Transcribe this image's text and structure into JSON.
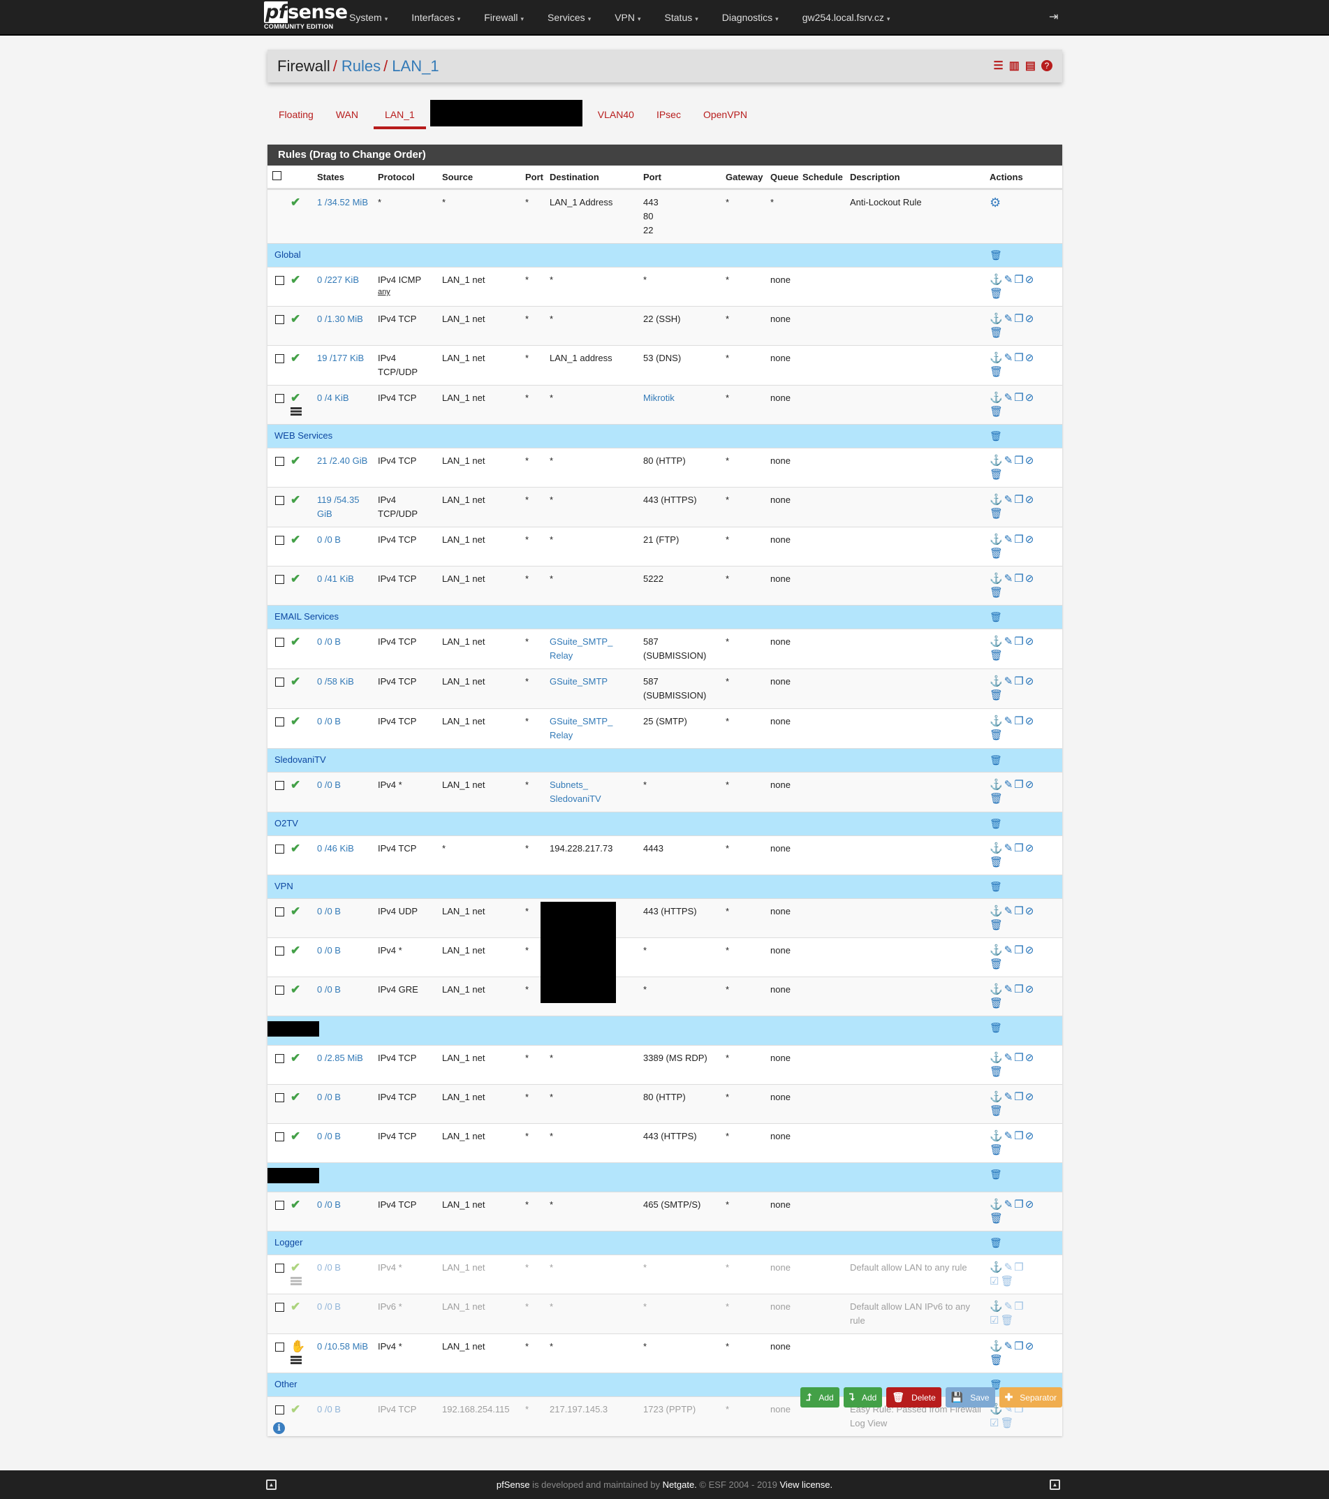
{
  "nav": {
    "brand": {
      "logo_pf": "pf",
      "logo_sense": "sense",
      "edition": "COMMUNITY EDITION"
    },
    "items": [
      {
        "label": "System"
      },
      {
        "label": "Interfaces"
      },
      {
        "label": "Firewall"
      },
      {
        "label": "Services"
      },
      {
        "label": "VPN"
      },
      {
        "label": "Status"
      },
      {
        "label": "Diagnostics"
      },
      {
        "label": "gw254.local.fsrv.cz"
      }
    ],
    "caret": "▾",
    "logout_icon": "⇥"
  },
  "breadcrumb": {
    "root": "Firewall",
    "sep": "/",
    "level1": "Rules",
    "level2": "LAN_1"
  },
  "header_icons": [
    "sliders-icon",
    "bar-chart-icon",
    "log-list-icon",
    "help-icon"
  ],
  "tabs": [
    {
      "label": "Floating",
      "active": false
    },
    {
      "label": "WAN",
      "active": false
    },
    {
      "label": "LAN_1",
      "active": true
    },
    {
      "label": "",
      "redacted": true
    },
    {
      "label": "VLAN40",
      "active": false
    },
    {
      "label": "IPsec",
      "active": false
    },
    {
      "label": "OpenVPN",
      "active": false
    }
  ],
  "panel": {
    "title": "Rules (Drag to Change Order)",
    "columns": [
      "",
      "",
      "States",
      "Protocol",
      "Source",
      "Port",
      "Destination",
      "Port",
      "Gateway",
      "Queue",
      "Schedule",
      "Description",
      "Actions"
    ],
    "anti_lockout": {
      "states": "1 /34.52 MiB",
      "protocol": "*",
      "source": "*",
      "sport": "*",
      "destination": "LAN_1 Address",
      "dport": "443\n80\n22",
      "gateway": "*",
      "queue": "*",
      "schedule": "",
      "description": "Anti-Lockout Rule"
    },
    "groups": [
      {
        "name": "Global",
        "rules": [
          {
            "states": "0 /227 KiB",
            "protocol": "IPv4 ICMP",
            "icmp_type": "any",
            "source": "LAN_1 net",
            "sport": "*",
            "destination": "*",
            "dport": "*",
            "gateway": "*",
            "queue": "none",
            "schedule": "",
            "description": "",
            "status": "pass"
          },
          {
            "states": "0 /1.30 MiB",
            "protocol": "IPv4 TCP",
            "source": "LAN_1 net",
            "sport": "*",
            "destination": "*",
            "dport": "22 (SSH)",
            "gateway": "*",
            "queue": "none",
            "schedule": "",
            "description": "",
            "status": "pass"
          },
          {
            "states": "19 /177 KiB",
            "protocol": "IPv4 TCP/UDP",
            "source": "LAN_1 net",
            "sport": "*",
            "destination": "LAN_1 address",
            "dport": "53 (DNS)",
            "gateway": "*",
            "queue": "none",
            "schedule": "",
            "description": "",
            "status": "pass"
          },
          {
            "states": "0 /4 KiB",
            "protocol": "IPv4 TCP",
            "source": "LAN_1 net",
            "sport": "*",
            "destination": "*",
            "dport": "Mikrotik",
            "dport_link": true,
            "gateway": "*",
            "queue": "none",
            "schedule": "",
            "description": "",
            "status": "pass",
            "log": true
          }
        ]
      },
      {
        "name": "WEB Services",
        "rules": [
          {
            "states": "21 /2.40 GiB",
            "protocol": "IPv4 TCP",
            "source": "LAN_1 net",
            "sport": "*",
            "destination": "*",
            "dport": "80 (HTTP)",
            "gateway": "*",
            "queue": "none",
            "schedule": "",
            "description": "",
            "status": "pass"
          },
          {
            "states": "119 /54.35 GiB",
            "protocol": "IPv4 TCP/UDP",
            "source": "LAN_1 net",
            "sport": "*",
            "destination": "*",
            "dport": "443 (HTTPS)",
            "gateway": "*",
            "queue": "none",
            "schedule": "",
            "description": "",
            "status": "pass"
          },
          {
            "states": "0 /0 B",
            "protocol": "IPv4 TCP",
            "source": "LAN_1 net",
            "sport": "*",
            "destination": "*",
            "dport": "21 (FTP)",
            "gateway": "*",
            "queue": "none",
            "schedule": "",
            "description": "",
            "status": "pass"
          },
          {
            "states": "0 /41 KiB",
            "protocol": "IPv4 TCP",
            "source": "LAN_1 net",
            "sport": "*",
            "destination": "*",
            "dport": "5222",
            "gateway": "*",
            "queue": "none",
            "schedule": "",
            "description": "",
            "status": "pass"
          }
        ]
      },
      {
        "name": "EMAIL Services",
        "rules": [
          {
            "states": "0 /0 B",
            "protocol": "IPv4 TCP",
            "source": "LAN_1 net",
            "sport": "*",
            "destination": "GSuite_SMTP_ Relay",
            "dest_link": true,
            "dport": "587 (SUBMISSION)",
            "gateway": "*",
            "queue": "none",
            "schedule": "",
            "description": "",
            "status": "pass"
          },
          {
            "states": "0 /58 KiB",
            "protocol": "IPv4 TCP",
            "source": "LAN_1 net",
            "sport": "*",
            "destination": "GSuite_SMTP",
            "dest_link": true,
            "dport": "587 (SUBMISSION)",
            "gateway": "*",
            "queue": "none",
            "schedule": "",
            "description": "",
            "status": "pass"
          },
          {
            "states": "0 /0 B",
            "protocol": "IPv4 TCP",
            "source": "LAN_1 net",
            "sport": "*",
            "destination": "GSuite_SMTP_ Relay",
            "dest_link": true,
            "dport": "25 (SMTP)",
            "gateway": "*",
            "queue": "none",
            "schedule": "",
            "description": "",
            "status": "pass"
          }
        ]
      },
      {
        "name": "SledovaniTV",
        "rules": [
          {
            "states": "0 /0 B",
            "protocol": "IPv4 *",
            "source": "LAN_1 net",
            "sport": "*",
            "destination": "Subnets_ SledovaniTV",
            "dest_link": true,
            "dport": "*",
            "gateway": "*",
            "queue": "none",
            "schedule": "",
            "description": "",
            "status": "pass"
          }
        ]
      },
      {
        "name": "O2TV",
        "rules": [
          {
            "states": "0 /46 KiB",
            "protocol": "IPv4 TCP",
            "source": "*",
            "sport": "*",
            "destination": "194.228.217.73",
            "dport": "4443",
            "gateway": "*",
            "queue": "none",
            "schedule": "",
            "description": "",
            "status": "pass"
          }
        ]
      },
      {
        "name": "VPN",
        "rules": [
          {
            "states": "0 /0 B",
            "protocol": "IPv4 UDP",
            "source": "LAN_1 net",
            "sport": "*",
            "destination": "",
            "dest_redacted": true,
            "dport": "443 (HTTPS)",
            "gateway": "*",
            "queue": "none",
            "schedule": "",
            "description": "",
            "status": "pass"
          },
          {
            "states": "0 /0 B",
            "protocol": "IPv4 *",
            "source": "LAN_1 net",
            "sport": "*",
            "destination": "",
            "dest_redacted": true,
            "dport": "*",
            "gateway": "*",
            "queue": "none",
            "schedule": "",
            "description": "",
            "status": "pass"
          },
          {
            "states": "0 /0 B",
            "protocol": "IPv4 GRE",
            "source": "LAN_1 net",
            "sport": "*",
            "destination": "",
            "dest_redacted": true,
            "dport": "*",
            "gateway": "*",
            "queue": "none",
            "schedule": "",
            "description": "",
            "status": "pass"
          }
        ]
      },
      {
        "name": "",
        "redacted": true,
        "rules": [
          {
            "states": "0 /2.85 MiB",
            "protocol": "IPv4 TCP",
            "source": "LAN_1 net",
            "sport": "*",
            "destination": "*",
            "dport": "3389 (MS RDP)",
            "gateway": "*",
            "queue": "none",
            "schedule": "",
            "description": "",
            "status": "pass"
          },
          {
            "states": "0 /0 B",
            "protocol": "IPv4 TCP",
            "source": "LAN_1 net",
            "sport": "*",
            "destination": "*",
            "dport": "80 (HTTP)",
            "gateway": "*",
            "queue": "none",
            "schedule": "",
            "description": "",
            "status": "pass"
          },
          {
            "states": "0 /0 B",
            "protocol": "IPv4 TCP",
            "source": "LAN_1 net",
            "sport": "*",
            "destination": "*",
            "dport": "443 (HTTPS)",
            "gateway": "*",
            "queue": "none",
            "schedule": "",
            "description": "",
            "status": "pass"
          }
        ]
      },
      {
        "name": "",
        "redacted": true,
        "rules": [
          {
            "states": "0 /0 B",
            "protocol": "IPv4 TCP",
            "source": "LAN_1 net",
            "sport": "*",
            "destination": "*",
            "dport": "465 (SMTP/S)",
            "gateway": "*",
            "queue": "none",
            "schedule": "",
            "description": "",
            "status": "pass"
          }
        ]
      },
      {
        "name": "Logger",
        "rules": [
          {
            "states": "0 /0 B",
            "protocol": "IPv4 *",
            "source": "LAN_1 net",
            "sport": "*",
            "destination": "*",
            "dport": "*",
            "gateway": "*",
            "queue": "none",
            "schedule": "",
            "description": "Default allow LAN to any rule",
            "status": "pass",
            "disabled": true,
            "log": true
          },
          {
            "states": "0 /0 B",
            "protocol": "IPv6 *",
            "source": "LAN_1 net",
            "sport": "*",
            "destination": "*",
            "dport": "*",
            "gateway": "*",
            "queue": "none",
            "schedule": "",
            "description": "Default allow LAN IPv6 to any rule",
            "status": "pass",
            "disabled": true
          },
          {
            "states": "0 /10.58 MiB",
            "protocol": "IPv4 *",
            "source": "LAN_1 net",
            "sport": "*",
            "destination": "*",
            "dport": "*",
            "gateway": "*",
            "queue": "none",
            "schedule": "",
            "description": "",
            "status": "match",
            "log": true
          }
        ]
      },
      {
        "name": "Other",
        "rules": [
          {
            "states": "0 /0 B",
            "protocol": "IPv4 TCP",
            "source": "192.168.254.115",
            "sport": "*",
            "destination": "217.197.145.3",
            "dport": "1723 (PPTP)",
            "gateway": "*",
            "queue": "none",
            "schedule": "",
            "description": "Easy Rule: Passed from Firewall Log View",
            "status": "pass",
            "disabled": true
          }
        ]
      }
    ]
  },
  "buttons": {
    "add_top": "Add",
    "add_bottom": "Add",
    "delete": "Delete",
    "save": "Save",
    "separator": "Separator"
  },
  "colors": {
    "brand_red": "#b71c1c",
    "link_blue": "#337ab7",
    "separator_bg": "#b3e5fc",
    "pass_green": "#43a047"
  },
  "footer": {
    "brand": "pfSense",
    "text1": " is developed and maintained by ",
    "company": "Netgate.",
    "text2": " © ESF 2004 - 2019 ",
    "license": "View license."
  }
}
